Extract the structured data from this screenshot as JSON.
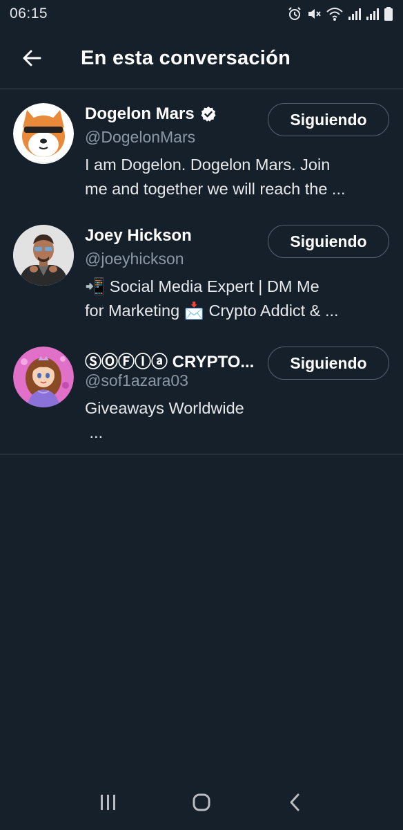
{
  "status_bar": {
    "time": "06:15",
    "icons": [
      "alarm-icon",
      "mute-icon",
      "wifi-icon",
      "signal-icon",
      "signal-icon",
      "battery-icon"
    ]
  },
  "header": {
    "back_icon": "arrow-left-icon",
    "title": "En esta conversación"
  },
  "users": [
    {
      "name": "Dogelon Mars",
      "verified": true,
      "handle": "@DogelonMars",
      "bio_lines": [
        "I am Dogelon. Dogelon Mars. Join",
        "me and together we will reach the ..."
      ],
      "button_label": "Siguiendo"
    },
    {
      "name": "Joey Hickson",
      "verified": false,
      "handle": "@joeyhickson",
      "bio_lines": [
        "📲 Social Media Expert | DM Me",
        "for Marketing 📩 Crypto Addict & ..."
      ],
      "button_label": "Siguiendo"
    },
    {
      "name": "ⓈⓄⒻⒾⓐ CRYPTO...",
      "verified": false,
      "handle": "@sof1azara03",
      "bio_lines": [
        "Giveaways Worldwide",
        " ..."
      ],
      "button_label": "Siguiendo"
    }
  ],
  "nav_bar": {
    "icons": [
      "recent-apps-icon",
      "home-icon",
      "back-icon"
    ]
  },
  "colors": {
    "background": "#15202b",
    "divider": "#38444d",
    "secondary_text": "#8b98a5",
    "button_border": "#536471"
  }
}
